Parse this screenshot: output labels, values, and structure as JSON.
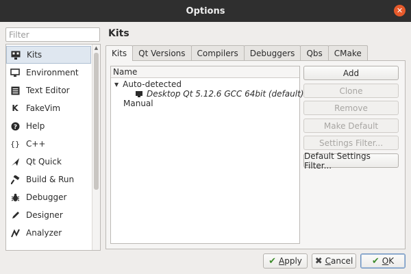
{
  "window": {
    "title": "Options"
  },
  "filter": {
    "placeholder": "Filter",
    "value": ""
  },
  "sidebar": {
    "items": [
      {
        "label": "Kits",
        "icon": "kits-icon",
        "selected": true
      },
      {
        "label": "Environment",
        "icon": "monitor-icon"
      },
      {
        "label": "Text Editor",
        "icon": "text-editor-icon"
      },
      {
        "label": "FakeVim",
        "icon": "fakevim-icon"
      },
      {
        "label": "Help",
        "icon": "help-icon"
      },
      {
        "label": "C++",
        "icon": "braces-icon"
      },
      {
        "label": "Qt Quick",
        "icon": "qt-quick-icon"
      },
      {
        "label": "Build & Run",
        "icon": "hammer-icon"
      },
      {
        "label": "Debugger",
        "icon": "bug-icon"
      },
      {
        "label": "Designer",
        "icon": "pen-icon"
      },
      {
        "label": "Analyzer",
        "icon": "analyzer-icon"
      }
    ]
  },
  "page": {
    "title": "Kits"
  },
  "tabs": [
    {
      "label": "Kits",
      "active": true
    },
    {
      "label": "Qt Versions"
    },
    {
      "label": "Compilers"
    },
    {
      "label": "Debuggers"
    },
    {
      "label": "Qbs"
    },
    {
      "label": "CMake"
    }
  ],
  "tree": {
    "header": "Name",
    "groups": [
      {
        "label": "Auto-detected",
        "expanded": true,
        "children": [
          {
            "label": "Desktop Qt 5.12.6 GCC 64bit (default)"
          }
        ]
      },
      {
        "label": "Manual",
        "children": []
      }
    ]
  },
  "actions": {
    "add": "Add",
    "clone": "Clone",
    "remove": "Remove",
    "make_default": "Make Default",
    "settings_filter": "Settings Filter...",
    "default_settings_filter": "Default Settings Filter..."
  },
  "footer": {
    "apply": "Apply",
    "cancel": "Cancel",
    "ok": "OK"
  },
  "colors": {
    "titlebar": "#2f2f2f",
    "close": "#e65a2b",
    "selection": "#dfe7f0",
    "ok_accent": "#3d8b2b"
  }
}
